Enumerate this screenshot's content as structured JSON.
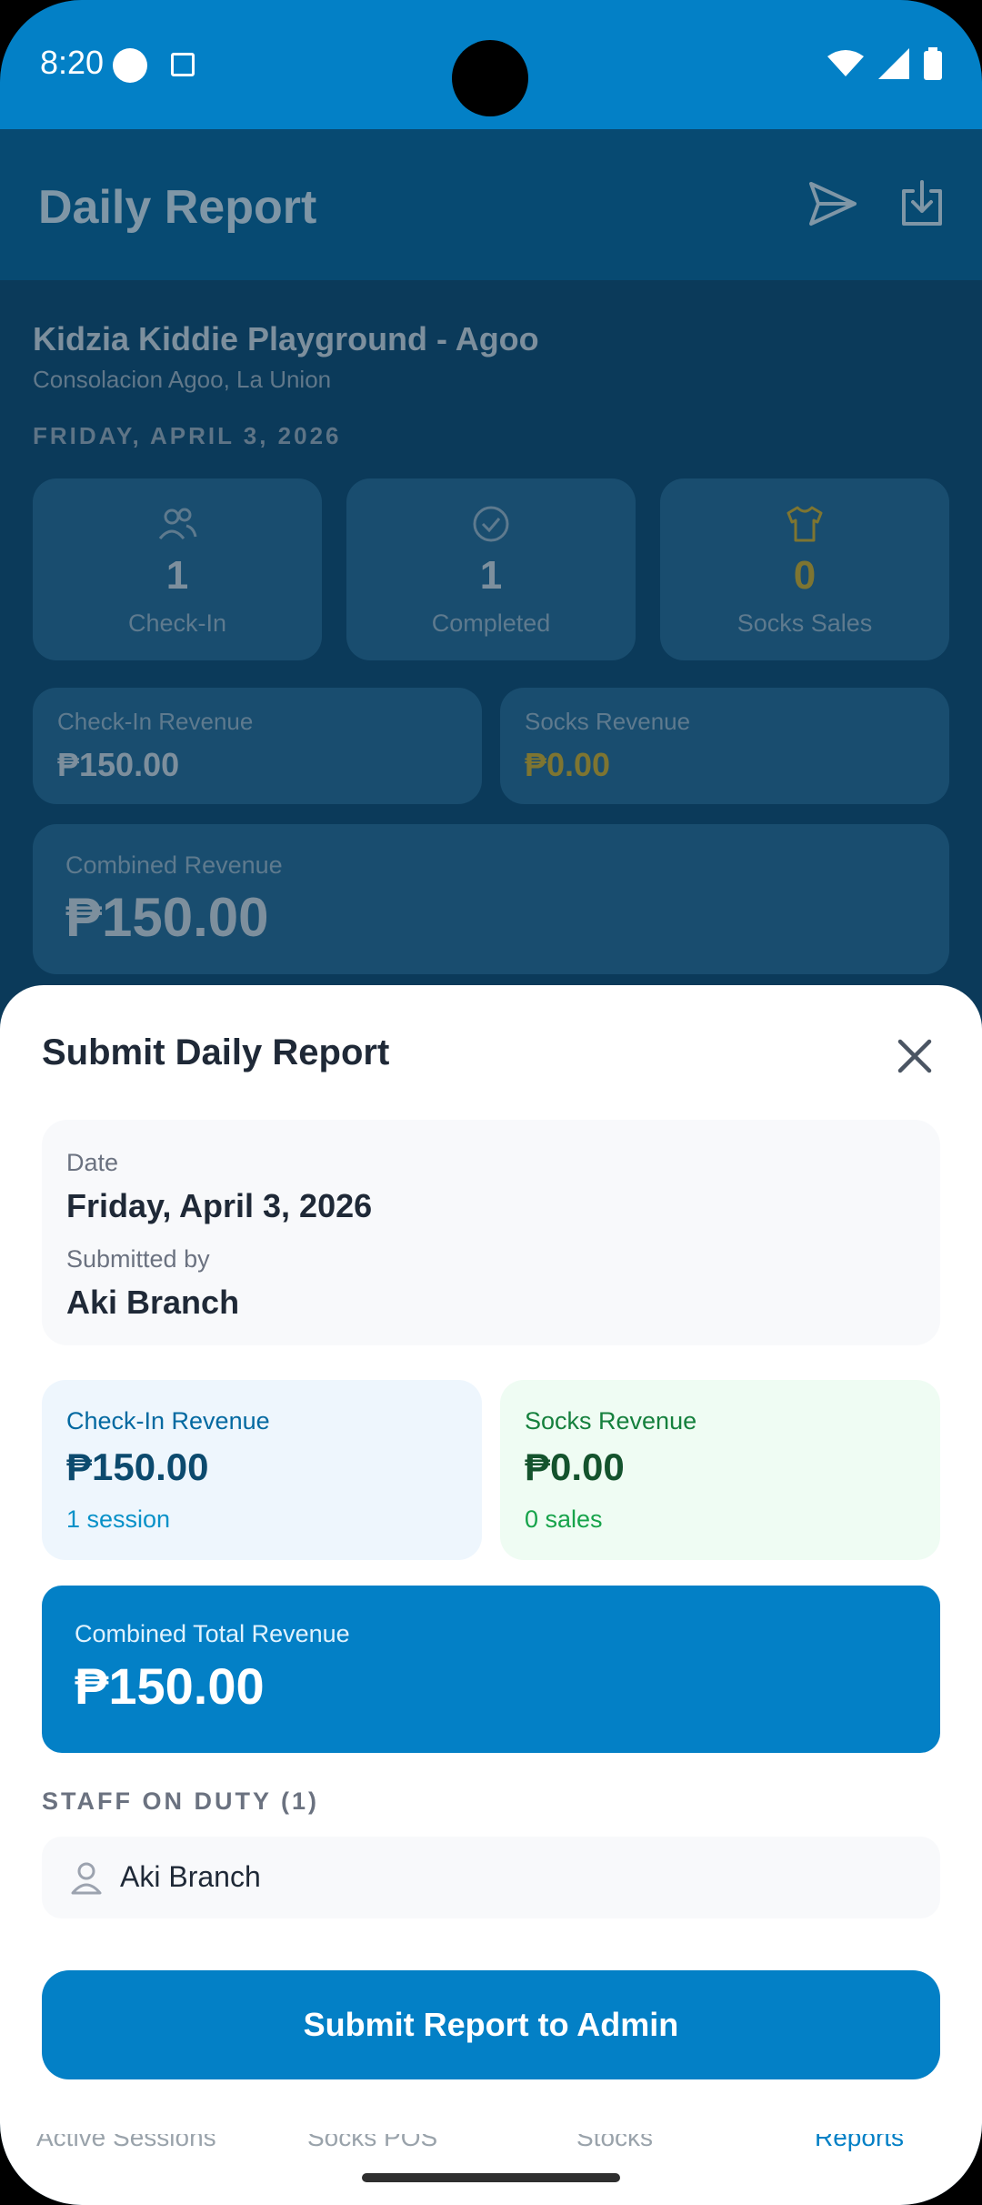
{
  "status_bar": {
    "time": "8:20"
  },
  "app_bar": {
    "title": "Daily Report",
    "send_icon": "send-icon",
    "download_icon": "download-icon"
  },
  "background": {
    "branch_name": "Kidzia Kiddie Playground - Agoo",
    "branch_location": "Consolacion Agoo, La Union",
    "date_heading": "FRIDAY, APRIL 3, 2026",
    "stats": [
      {
        "value": "1",
        "label": "Check-In",
        "icon": "users-icon"
      },
      {
        "value": "1",
        "label": "Completed",
        "icon": "check-circle-icon"
      },
      {
        "value": "0",
        "label": "Socks Sales",
        "icon": "shirt-icon"
      }
    ],
    "checkin_revenue": {
      "label": "Check-In Revenue",
      "value": "₱150.00"
    },
    "socks_revenue": {
      "label": "Socks Revenue",
      "value": "₱0.00"
    },
    "combined_revenue": {
      "label": "Combined Revenue",
      "value": "₱150.00"
    },
    "nav": [
      "Active Sessions",
      "Socks POS",
      "Stocks",
      "Reports"
    ]
  },
  "sheet": {
    "title": "Submit Daily Report",
    "date_label": "Date",
    "date_value": "Friday, April 3, 2026",
    "submitted_by_label": "Submitted by",
    "submitted_by_value": "Aki Branch",
    "checkin": {
      "label": "Check-In Revenue",
      "value": "₱150.00",
      "sub": "1 session"
    },
    "socks": {
      "label": "Socks Revenue",
      "value": "₱0.00",
      "sub": "0 sales"
    },
    "total": {
      "label": "Combined Total Revenue",
      "value": "₱150.00"
    },
    "staff_heading": "STAFF ON DUTY (1)",
    "staff": [
      {
        "name": "Aki Branch"
      }
    ],
    "submit_label": "Submit Report to Admin"
  },
  "colors": {
    "primary": "#0380c6",
    "gold": "#eab308",
    "green": "#16a34a"
  }
}
